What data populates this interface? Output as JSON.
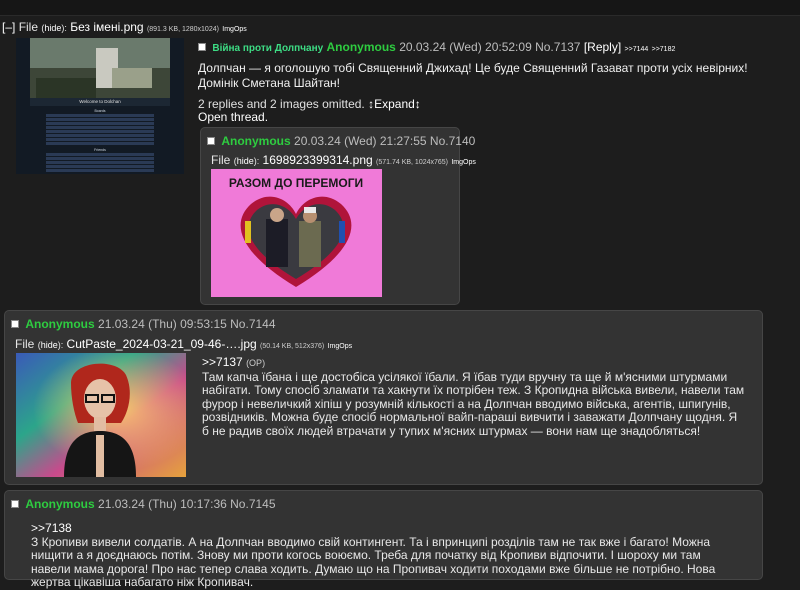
{
  "op": {
    "expand_toggle": "[–]",
    "file_label": "File",
    "hide_label": "hide",
    "filename": "Без імені.png",
    "file_meta": "(891.3 KB, 1280x1024)",
    "imgops": "ImgOps",
    "thumb": {
      "title": "Welcome to Dolchan",
      "boards_header": "Boards",
      "friends_header": "Friends"
    },
    "subject": "Війна проти Долпчану",
    "name": "Anonymous",
    "date": "20.03.24 (Wed) 20:52:09",
    "post_no": "No.7137",
    "reply_link": "[Reply]",
    "backlinks": [
      ">>7144",
      ">>7182"
    ],
    "body": "Долпчан — я оголошую тобі Священний Джихад! Це буде Священний Газават проти усіх невірних! Домінік Сметана Шайтан!",
    "omitted": "2 replies and 2 images omitted.",
    "expand": "↕Expand↕",
    "open_thread": "Open thread",
    "open_thread_dot": "."
  },
  "reply1": {
    "name": "Anonymous",
    "date": "20.03.24 (Wed) 21:27:55",
    "post_no": "No.7140",
    "file_label": "File",
    "hide_label": "hide",
    "filename": "1698923399314.png",
    "file_meta": "(571.74 KB, 1024x765)",
    "imgops": "ImgOps",
    "image_caption": "РАЗОМ ДО ПЕРЕМОГИ"
  },
  "reply2": {
    "name": "Anonymous",
    "date": "21.03.24 (Thu) 09:53:15",
    "post_no": "No.7144",
    "file_label": "File",
    "hide_label": "hide",
    "filename": "CutPaste_2024-03-21_09-46-….jpg",
    "file_meta": "(50.14 KB, 512x376)",
    "imgops": "ImgOps",
    "quote": ">>7137",
    "op_tag": "(OP)",
    "body": "Там капча їбана і ще достобіса усілякої їбали. Я їбав туди вручну та ще й м'ясними штурмами набігати. Тому спосіб зламати та хакнути їх потрібен теж. З Кропидна військa вивели, навели там фурор і невеличкий хіпіш у розумній кількості а на Долпчан вводимо війська, агентів, шпигунів, розвідників. Можна буде спосіб нормальної вайп-параші вивчити і заважати Долпчану щодня. Я б не радив своїх людей втрачати у тупих м'ясних штурмах — вони нам ще знадобляться!"
  },
  "reply3": {
    "name": "Anonymous",
    "date": "21.03.24 (Thu) 10:17:36",
    "post_no": "No.7145",
    "quote": ">>7138",
    "body": "З Кропиви вивели солдатів. А на Долпчан вводимо свій контингент. Та і впринципі розділів там не так вже і багато! Можна нищити а я доєднаюсь потім. Знову ми проти когось воюємо. Треба для початку від Кропиви відпочити. І шороху ми там навели мама дорога! Про нас тепер слава ходить. Думаю що на Пропивач ходити походами вже більше не потрібно. Нова жертва цікавіша набагато ніж Кропивач."
  },
  "colors": {
    "background": "#1d1d1d",
    "reply_background": "#333333",
    "name": "#2ecc40",
    "subject": "#3ddc84"
  }
}
